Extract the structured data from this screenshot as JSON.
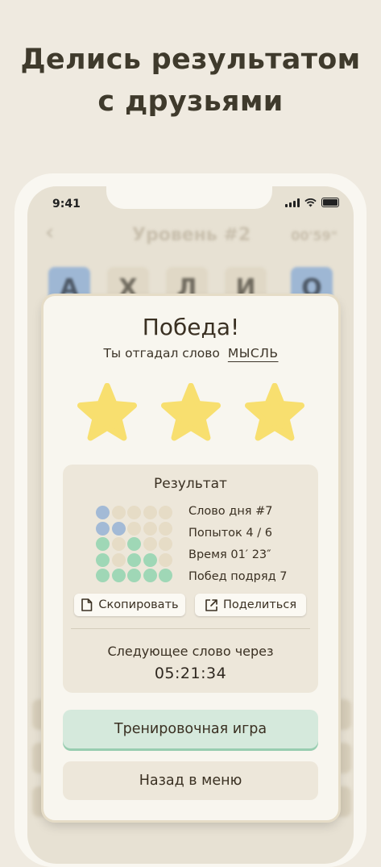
{
  "promo": {
    "line1": "Делись результатом",
    "line2": "с друзьями"
  },
  "status_bar": {
    "time": "9:41"
  },
  "background_game": {
    "title": "Уровень #2",
    "timer": "00'59\"",
    "tiles": [
      {
        "letter": "А",
        "state": "blue"
      },
      {
        "letter": "Х",
        "state": "neutral"
      },
      {
        "letter": "Л",
        "state": "neutral"
      },
      {
        "letter": "И",
        "state": "neutral"
      },
      {
        "letter": "О",
        "state": "blue"
      }
    ]
  },
  "modal": {
    "title": "Победа!",
    "guessed_prefix": "Ты отгадал слово",
    "guessed_word": "МЫСЛЬ",
    "stars_earned": 3,
    "result": {
      "title": "Результат",
      "grid": [
        [
          "blue",
          "beige",
          "beige",
          "beige",
          "beige"
        ],
        [
          "blue",
          "blue",
          "beige",
          "beige",
          "beige"
        ],
        [
          "green",
          "beige",
          "green",
          "beige",
          "beige"
        ],
        [
          "green",
          "beige",
          "green",
          "green",
          "beige"
        ],
        [
          "green",
          "green",
          "green",
          "green",
          "green"
        ]
      ],
      "stats": [
        "Слово дня #7",
        "Попыток 4 / 6",
        "Время 01′ 23″",
        "Побед подряд 7"
      ],
      "copy_label": "Скопировать",
      "share_label": "Поделиться",
      "next_label": "Следующее слово через",
      "next_timer": "05:21:34"
    },
    "practice_button": "Тренировочная игра",
    "menu_button": "Назад в меню"
  },
  "colors": {
    "blue": "#a3bad6",
    "beige": "#e6dcc6",
    "green": "#9fd7b6",
    "star": "#f8df6f"
  }
}
